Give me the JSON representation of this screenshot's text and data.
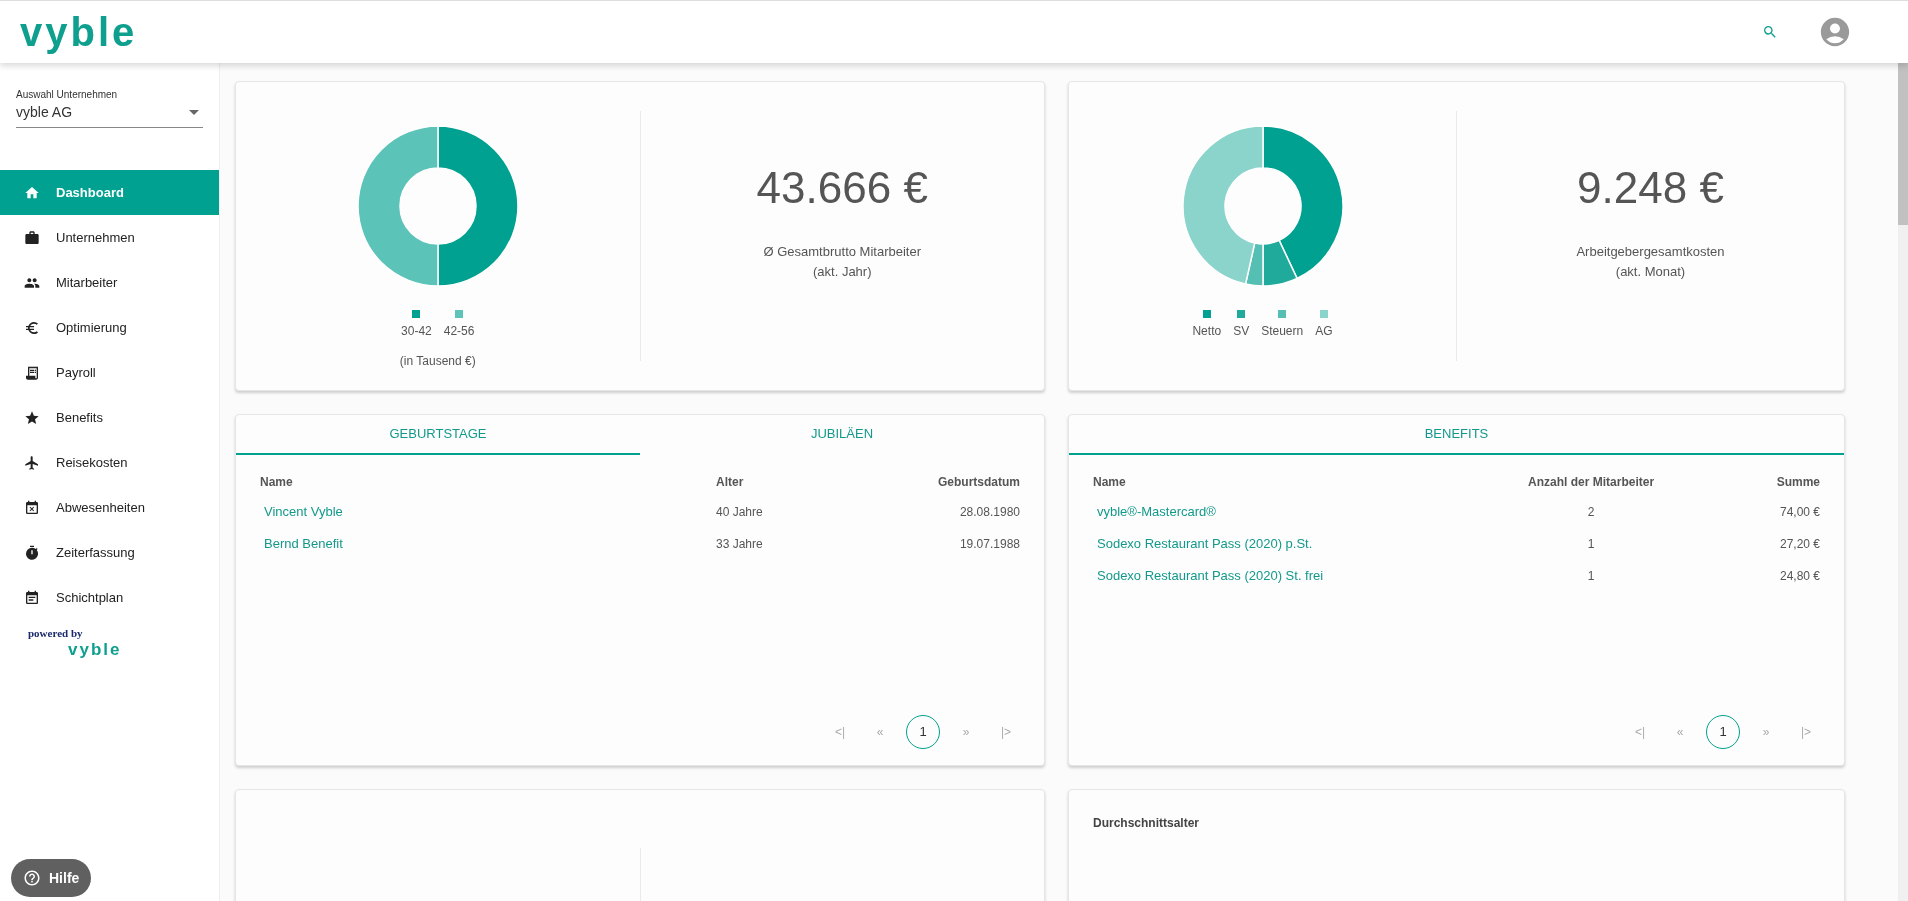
{
  "header": {
    "logo": "vyble"
  },
  "company_select": {
    "label": "Auswahl Unternehmen",
    "value": "vyble AG"
  },
  "sidebar": {
    "items": [
      {
        "label": "Dashboard",
        "selected": true
      },
      {
        "label": "Unternehmen",
        "selected": false
      },
      {
        "label": "Mitarbeiter",
        "selected": false
      },
      {
        "label": "Optimierung",
        "selected": false
      },
      {
        "label": "Payroll",
        "selected": false
      },
      {
        "label": "Benefits",
        "selected": false
      },
      {
        "label": "Reisekosten",
        "selected": false
      },
      {
        "label": "Abwesenheiten",
        "selected": false
      },
      {
        "label": "Zeiterfassung",
        "selected": false
      },
      {
        "label": "Schichtplan",
        "selected": false
      }
    ],
    "powered_by": {
      "text": "powered by",
      "logo": "vyble"
    }
  },
  "help_button": {
    "label": "Hilfe"
  },
  "stat_cards": [
    {
      "legend": [
        {
          "label": "30-42",
          "color": "#00a190"
        },
        {
          "label": "42-56",
          "color": "#5cc3b8"
        }
      ],
      "note": "(in Tausend €)",
      "value": "43.666 €",
      "caption": "Ø Gesamtbrutto Mitarbeiter\n(akt. Jahr)"
    },
    {
      "legend": [
        {
          "label": "Netto",
          "color": "#00a190"
        },
        {
          "label": "SV",
          "color": "#1faa9b"
        },
        {
          "label": "Steuern",
          "color": "#55bfb3"
        },
        {
          "label": "AG",
          "color": "#8ad4cb"
        }
      ],
      "value": "9.248 €",
      "caption": "Arbeitgebergesamtkosten\n(akt. Monat)"
    }
  ],
  "birthdays_card": {
    "tabs": [
      {
        "label": "GEBURTSTAGE",
        "selected": true
      },
      {
        "label": "JUBILÄEN",
        "selected": false
      }
    ],
    "columns": [
      "Name",
      "Alter",
      "Geburtsdatum"
    ],
    "rows": [
      [
        "Vincent Vyble",
        "40 Jahre",
        "28.08.1980"
      ],
      [
        "Bernd Benefit",
        "33 Jahre",
        "19.07.1988"
      ]
    ],
    "pagination": {
      "first": "<|",
      "prev": "«",
      "pages": [
        {
          "label": "1",
          "selected": true
        }
      ],
      "next": "»",
      "last": "|>"
    }
  },
  "benefits_card": {
    "title": "BENEFITS",
    "columns": [
      "Name",
      "Anzahl der Mitarbeiter",
      "Summe"
    ],
    "rows": [
      [
        "vyble®-Mastercard®",
        "2",
        "74,00 €"
      ],
      [
        "Sodexo Restaurant Pass (2020) p.St.",
        "1",
        "27,20 €"
      ],
      [
        "Sodexo Restaurant Pass (2020) St. frei",
        "1",
        "24,80 €"
      ]
    ],
    "pagination": {
      "first": "<|",
      "prev": "«",
      "pages": [
        {
          "label": "1",
          "selected": true
        }
      ],
      "next": "»",
      "last": "|>"
    }
  },
  "average_age_card": {
    "title": "Durchschnittsalter"
  }
}
